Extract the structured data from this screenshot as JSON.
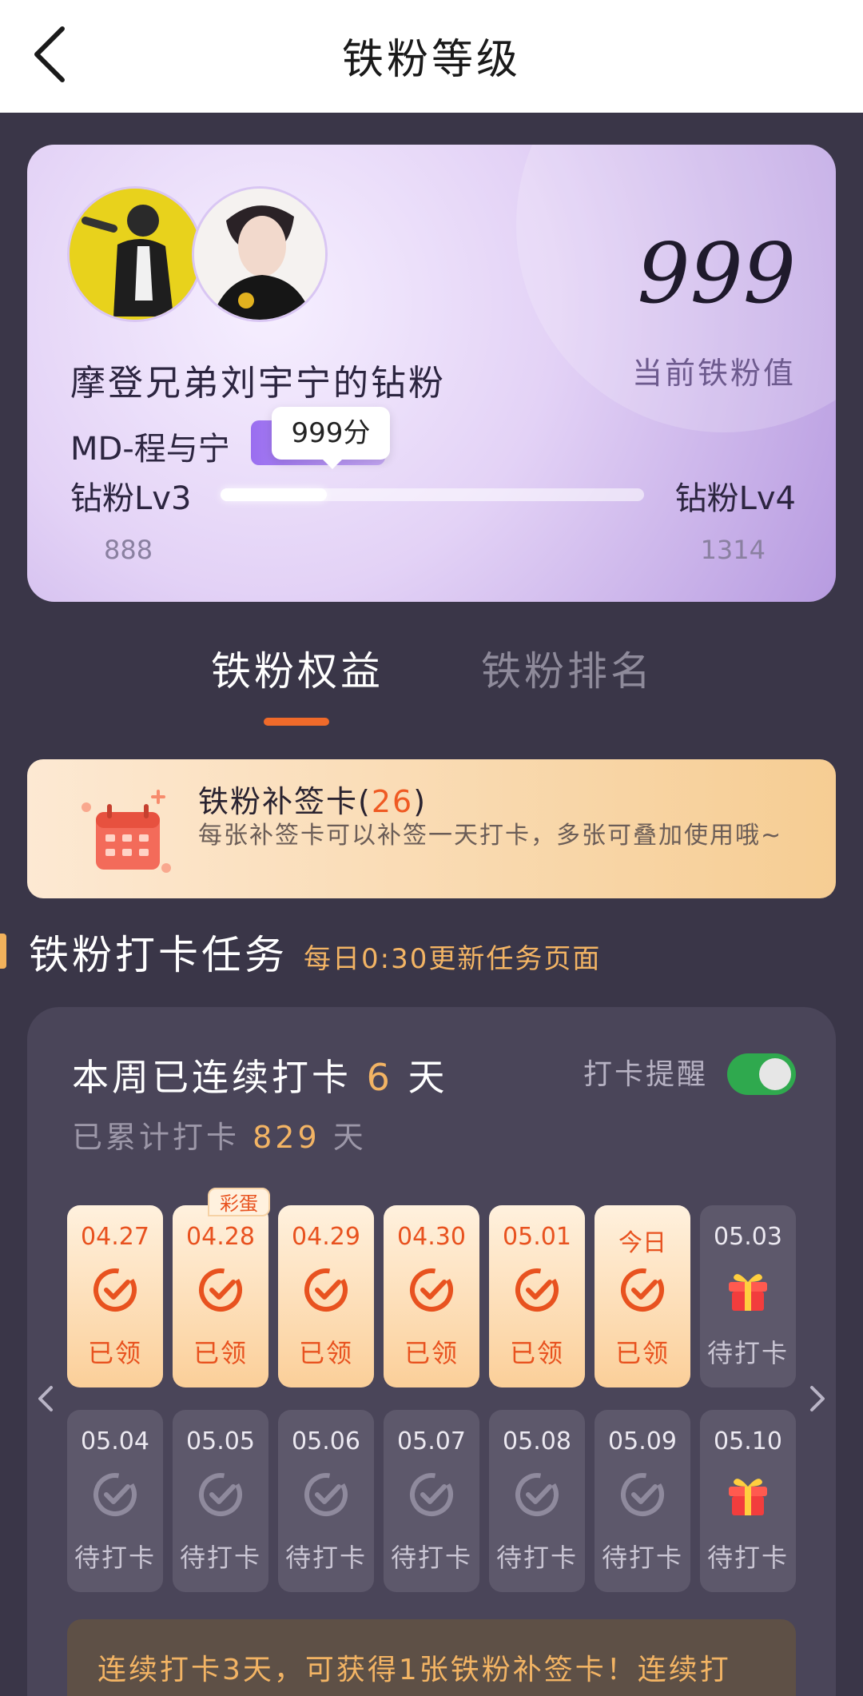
{
  "header": {
    "title": "铁粉等级",
    "back_icon": "back-arrow-icon"
  },
  "fan_card": {
    "current_value": "999",
    "current_value_label": "当前铁粉值",
    "title": "摩登兄弟刘宇宁的钻粉",
    "subtitle": "MD-程与宁",
    "bubble": "999分",
    "level_from": "钻粉Lv3",
    "level_to": "钻粉Lv4",
    "min_value": "888",
    "max_value": "1314",
    "progress_fraction": 0.25,
    "avatars": [
      "avatar-1",
      "avatar-2"
    ]
  },
  "tabs": [
    {
      "label": "铁粉权益",
      "active": true
    },
    {
      "label": "铁粉排名",
      "active": false
    }
  ],
  "makeup_card": {
    "title": "铁粉补签卡(",
    "count": "26",
    "title_end": ")",
    "desc": "每张补签卡可以补签一天打卡，多张可叠加使用哦~",
    "icon": "calendar-icon"
  },
  "tasks_section": {
    "title": "铁粉打卡任务",
    "subtitle": "每日0:30更新任务页面"
  },
  "checkin": {
    "streak_prefix": "本周已连续打卡",
    "streak_days": "6",
    "streak_suffix": "天",
    "total_prefix": "已累计打卡",
    "total_days": "829",
    "total_suffix": "天",
    "reminder_label": "打卡提醒",
    "reminder_on": true,
    "egg_badge": "彩蛋",
    "days": [
      {
        "date": "04.27",
        "status": "已领",
        "done": true,
        "icon": "check-icon"
      },
      {
        "date": "04.28",
        "status": "已领",
        "done": true,
        "icon": "check-icon",
        "egg": true
      },
      {
        "date": "04.29",
        "status": "已领",
        "done": true,
        "icon": "check-icon"
      },
      {
        "date": "04.30",
        "status": "已领",
        "done": true,
        "icon": "check-icon"
      },
      {
        "date": "05.01",
        "status": "已领",
        "done": true,
        "icon": "check-icon"
      },
      {
        "date": "今日",
        "status": "已领",
        "done": true,
        "icon": "check-icon"
      },
      {
        "date": "05.03",
        "status": "待打卡",
        "done": false,
        "icon": "gift-icon"
      },
      {
        "date": "05.04",
        "status": "待打卡",
        "done": false,
        "icon": "check-icon"
      },
      {
        "date": "05.05",
        "status": "待打卡",
        "done": false,
        "icon": "check-icon"
      },
      {
        "date": "05.06",
        "status": "待打卡",
        "done": false,
        "icon": "check-icon"
      },
      {
        "date": "05.07",
        "status": "待打卡",
        "done": false,
        "icon": "check-icon"
      },
      {
        "date": "05.08",
        "status": "待打卡",
        "done": false,
        "icon": "check-icon"
      },
      {
        "date": "05.09",
        "status": "待打卡",
        "done": false,
        "icon": "check-icon"
      },
      {
        "date": "05.10",
        "status": "待打卡",
        "done": false,
        "icon": "gift-icon"
      }
    ],
    "reward_text": "连续打卡3天，可获得1张铁粉补签卡！连续打"
  },
  "colors": {
    "accent": "#ef6a2a",
    "highlight": "#f3b464",
    "page_bg": "#3a3648",
    "toggle_on": "#2fa94e"
  }
}
